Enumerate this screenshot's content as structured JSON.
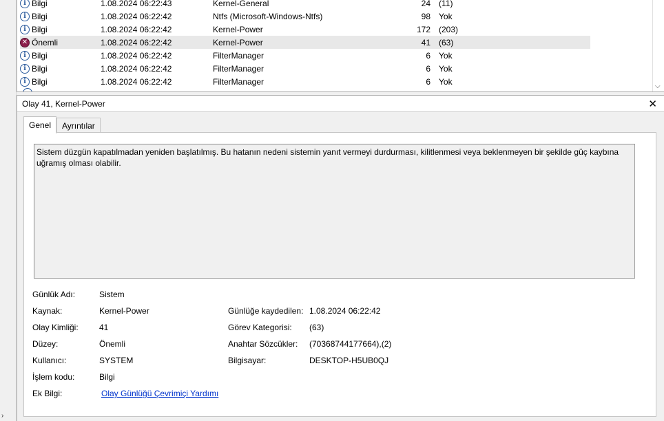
{
  "events": [
    {
      "level": "Bilgi",
      "type": "info",
      "date": "1.08.2024 06:22:43",
      "source": "Kernel-General",
      "id": "24",
      "category": "(11)"
    },
    {
      "level": "Bilgi",
      "type": "info",
      "date": "1.08.2024 06:22:42",
      "source": "Ntfs (Microsoft-Windows-Ntfs)",
      "id": "98",
      "category": "Yok"
    },
    {
      "level": "Bilgi",
      "type": "info",
      "date": "1.08.2024 06:22:42",
      "source": "Kernel-Power",
      "id": "172",
      "category": "(203)"
    },
    {
      "level": "Önemli",
      "type": "error",
      "date": "1.08.2024 06:22:42",
      "source": "Kernel-Power",
      "id": "41",
      "category": "(63)"
    },
    {
      "level": "Bilgi",
      "type": "info",
      "date": "1.08.2024 06:22:42",
      "source": "FilterManager",
      "id": "6",
      "category": "Yok"
    },
    {
      "level": "Bilgi",
      "type": "info",
      "date": "1.08.2024 06:22:42",
      "source": "FilterManager",
      "id": "6",
      "category": "Yok"
    },
    {
      "level": "Bilgi",
      "type": "info",
      "date": "1.08.2024 06:22:42",
      "source": "FilterManager",
      "id": "6",
      "category": "Yok"
    }
  ],
  "detail": {
    "title": "Olay 41, Kernel-Power",
    "close_glyph": "✕",
    "tabs": [
      "Genel",
      "Ayrıntılar"
    ],
    "description": "Sistem düzgün kapatılmadan yeniden başlatılmış. Bu hatanın nedeni sistemin yanıt vermeyi durdurması, kilitlenmesi veya beklenmeyen bir şekilde güç kaybına uğramış olması olabilir.",
    "fields": {
      "log_name_label": "Günlük Adı:",
      "log_name": "Sistem",
      "source_label": "Kaynak:",
      "source": "Kernel-Power",
      "logged_label": "Günlüğe kaydedilen:",
      "logged": "1.08.2024 06:22:42",
      "event_id_label": "Olay Kimliği:",
      "event_id": "41",
      "task_label": "Görev Kategorisi:",
      "task": "(63)",
      "level_label": "Düzey:",
      "level": "Önemli",
      "keywords_label": "Anahtar Sözcükler:",
      "keywords": "(70368744177664),(2)",
      "user_label": "Kullanıcı:",
      "user": "SYSTEM",
      "computer_label": "Bilgisayar:",
      "computer": "DESKTOP-H5UB0QJ",
      "opcode_label": "İşlem kodu:",
      "opcode": "Bilgi",
      "more_info_label": "Ek Bilgi:",
      "more_info_link": "Olay Günlüğü Çevrimiçi Yardımı"
    }
  },
  "colors": {
    "selected_row": "#e8e8e8",
    "link": "#0033cc",
    "error_icon": "#8b1e4a",
    "info_icon": "#2a5a9c"
  }
}
